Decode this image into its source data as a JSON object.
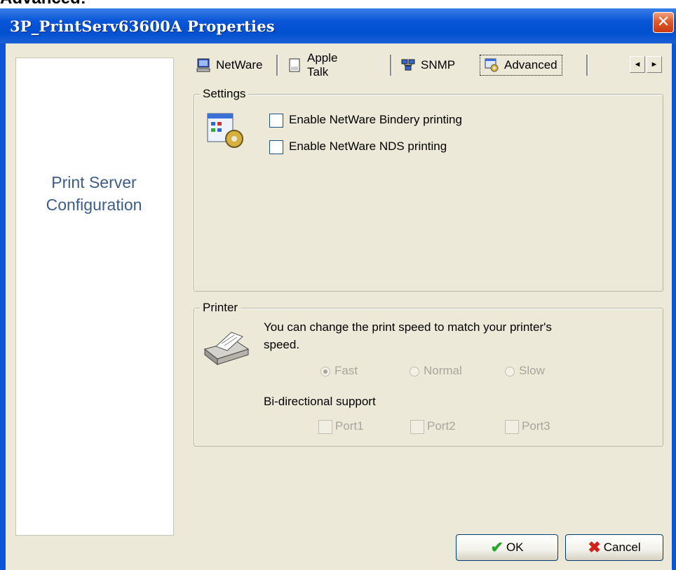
{
  "heading": "Advanced:",
  "window": {
    "title": "3P_PrintServ63600A Properties",
    "close_glyph": "✕"
  },
  "sidebar": {
    "line1": "Print Server",
    "line2": "Configuration"
  },
  "tabs": [
    {
      "label": "NetWare",
      "icon": "computer-icon"
    },
    {
      "label": "Apple Talk",
      "icon": "document-icon"
    },
    {
      "label": "SNMP",
      "icon": "network-icon"
    },
    {
      "label": "Advanced",
      "icon": "settings-icon",
      "active": true
    }
  ],
  "tab_scroll": {
    "left": "◄",
    "right": "►"
  },
  "settings": {
    "legend": "Settings",
    "bindery_label": "Enable NetWare Bindery printing",
    "bindery_checked": false,
    "nds_label": "Enable NetWare NDS printing",
    "nds_checked": false
  },
  "printer": {
    "legend": "Printer",
    "desc_line1": "You can change the print speed to match your printer's",
    "desc_line2": "speed.",
    "speed_options": [
      "Fast",
      "Normal",
      "Slow"
    ],
    "speed_selected": "Fast",
    "bidi_label": "Bi-directional support",
    "ports": [
      "Port1",
      "Port2",
      "Port3"
    ]
  },
  "buttons": {
    "ok": "OK",
    "cancel": "Cancel"
  },
  "colors": {
    "titlebar": "#0050d0",
    "sidebar_text": "#3e5d86",
    "dialog_bg": "#ece9d8"
  }
}
